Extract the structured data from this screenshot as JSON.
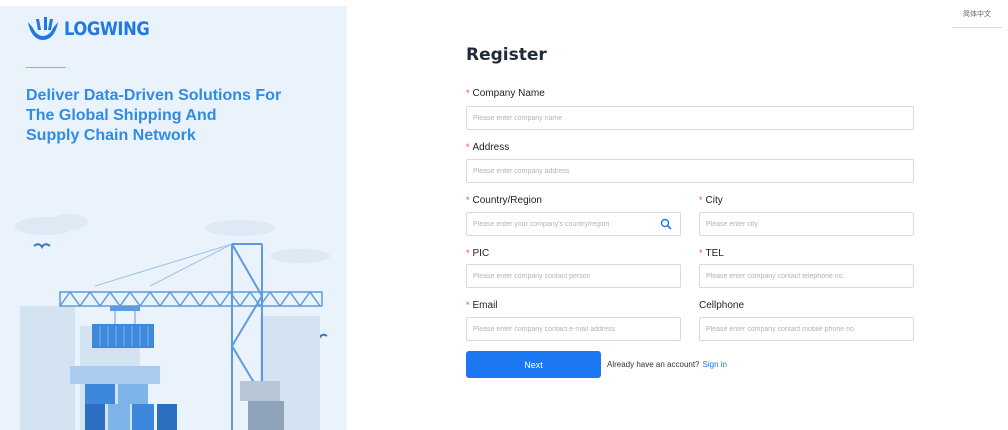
{
  "brand": {
    "name": "LOGWING",
    "color": "#1f78e6"
  },
  "hero": {
    "headline": [
      "Deliver Data-Driven Solutions For",
      "The Global Shipping And",
      "Supply Chain Network"
    ]
  },
  "language_switch": {
    "label": "简体中文"
  },
  "form": {
    "title": "Register",
    "fields": {
      "company_name": {
        "label": "Company Name",
        "required": true,
        "placeholder": "Please enter company name",
        "value": ""
      },
      "address": {
        "label": "Address",
        "required": true,
        "placeholder": "Please enter company address",
        "value": ""
      },
      "country_region": {
        "label": "Country/Region",
        "required": true,
        "placeholder": "Please enter your company's country/region",
        "value": "",
        "icon": "search-icon"
      },
      "city": {
        "label": "City",
        "required": true,
        "placeholder": "Please enter city",
        "value": ""
      },
      "pic": {
        "label": "PIC",
        "required": true,
        "placeholder": "Please enter company contact person",
        "value": ""
      },
      "tel": {
        "label": "TEL",
        "required": true,
        "placeholder": "Please enter company contact telephone no.",
        "value": ""
      },
      "email": {
        "label": "Email",
        "required": true,
        "placeholder": "Please enter company contact e-mail address",
        "value": ""
      },
      "cellphone": {
        "label": "Cellphone",
        "required": false,
        "placeholder": "Please enter company contact mobile phone no.",
        "value": ""
      }
    },
    "required_marker": "*",
    "next_label": "Next",
    "signin_prompt": "Already have an account?",
    "signin_link": "Sign in"
  },
  "colors": {
    "primary": "#1b78f2",
    "required": "#f5484b",
    "hero_bg": "#eaf3fb",
    "headline": "#2f8be6"
  }
}
